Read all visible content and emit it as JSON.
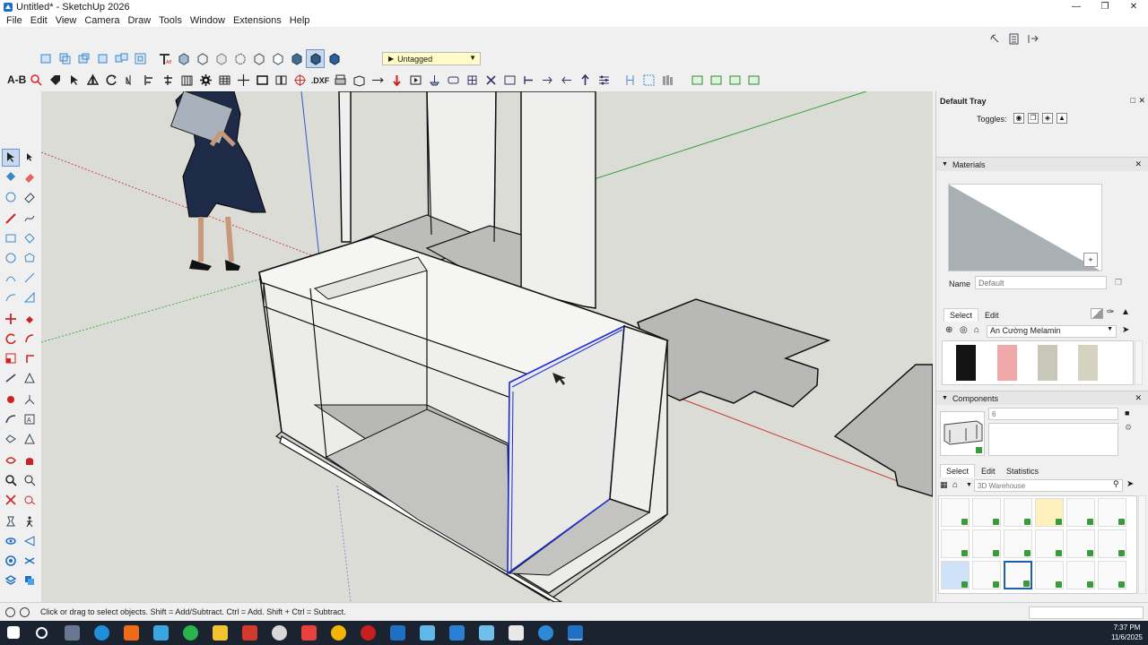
{
  "window": {
    "title": "Untitled* - SketchUp 2026"
  },
  "menu": [
    "File",
    "Edit",
    "View",
    "Camera",
    "Draw",
    "Tools",
    "Window",
    "Extensions",
    "Help"
  ],
  "toolbar": {
    "tag_value": "Untagged",
    "ab_label": "A-B",
    "dxf_label": ".DXF"
  },
  "tray": {
    "title": "Default Tray",
    "toggles_label": "Toggles:",
    "materials": {
      "header": "Materials",
      "name_label": "Name",
      "name_placeholder": "Default",
      "tabs": [
        "Select",
        "Edit"
      ],
      "library": "An Cường Melamin",
      "swatch_colors": [
        "#141414",
        "#f0a8a8",
        "#c9c7b8",
        "#d4d3c2"
      ]
    },
    "components": {
      "header": "Components",
      "count_value": "6",
      "tabs": [
        "Select",
        "Edit",
        "Statistics"
      ],
      "search_placeholder": "3D Warehouse"
    }
  },
  "status": {
    "hint": "Click or drag to select objects. Shift = Add/Subtract. Ctrl = Add. Shift + Ctrl = Subtract."
  },
  "clock": {
    "time": "7:37 PM",
    "date": "11/6/2025"
  },
  "colors": {
    "accent": "#6b95c9",
    "viewport": "#dcdcd6",
    "selection": "#1a2bd4",
    "tag_bg": "#fffbc8"
  }
}
